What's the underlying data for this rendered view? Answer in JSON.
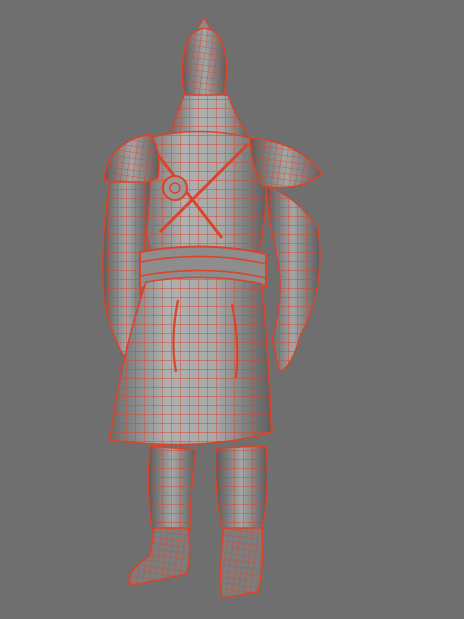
{
  "viewport": {
    "background": "#6f6f6f",
    "wire_color": "#d9442a",
    "shade_light": "#b5b5b5",
    "shade_mid": "#8f8f8f",
    "shade_dark": "#5f5f5f"
  },
  "model": {
    "parts": [
      "helmet",
      "head-neck",
      "torso",
      "left-pauldron",
      "right-pauldron",
      "left-arm",
      "right-arm",
      "belt",
      "tunic-skirt",
      "left-leg",
      "right-leg",
      "left-boot",
      "right-boot"
    ],
    "display_mode": "wireframe-on-shaded"
  }
}
